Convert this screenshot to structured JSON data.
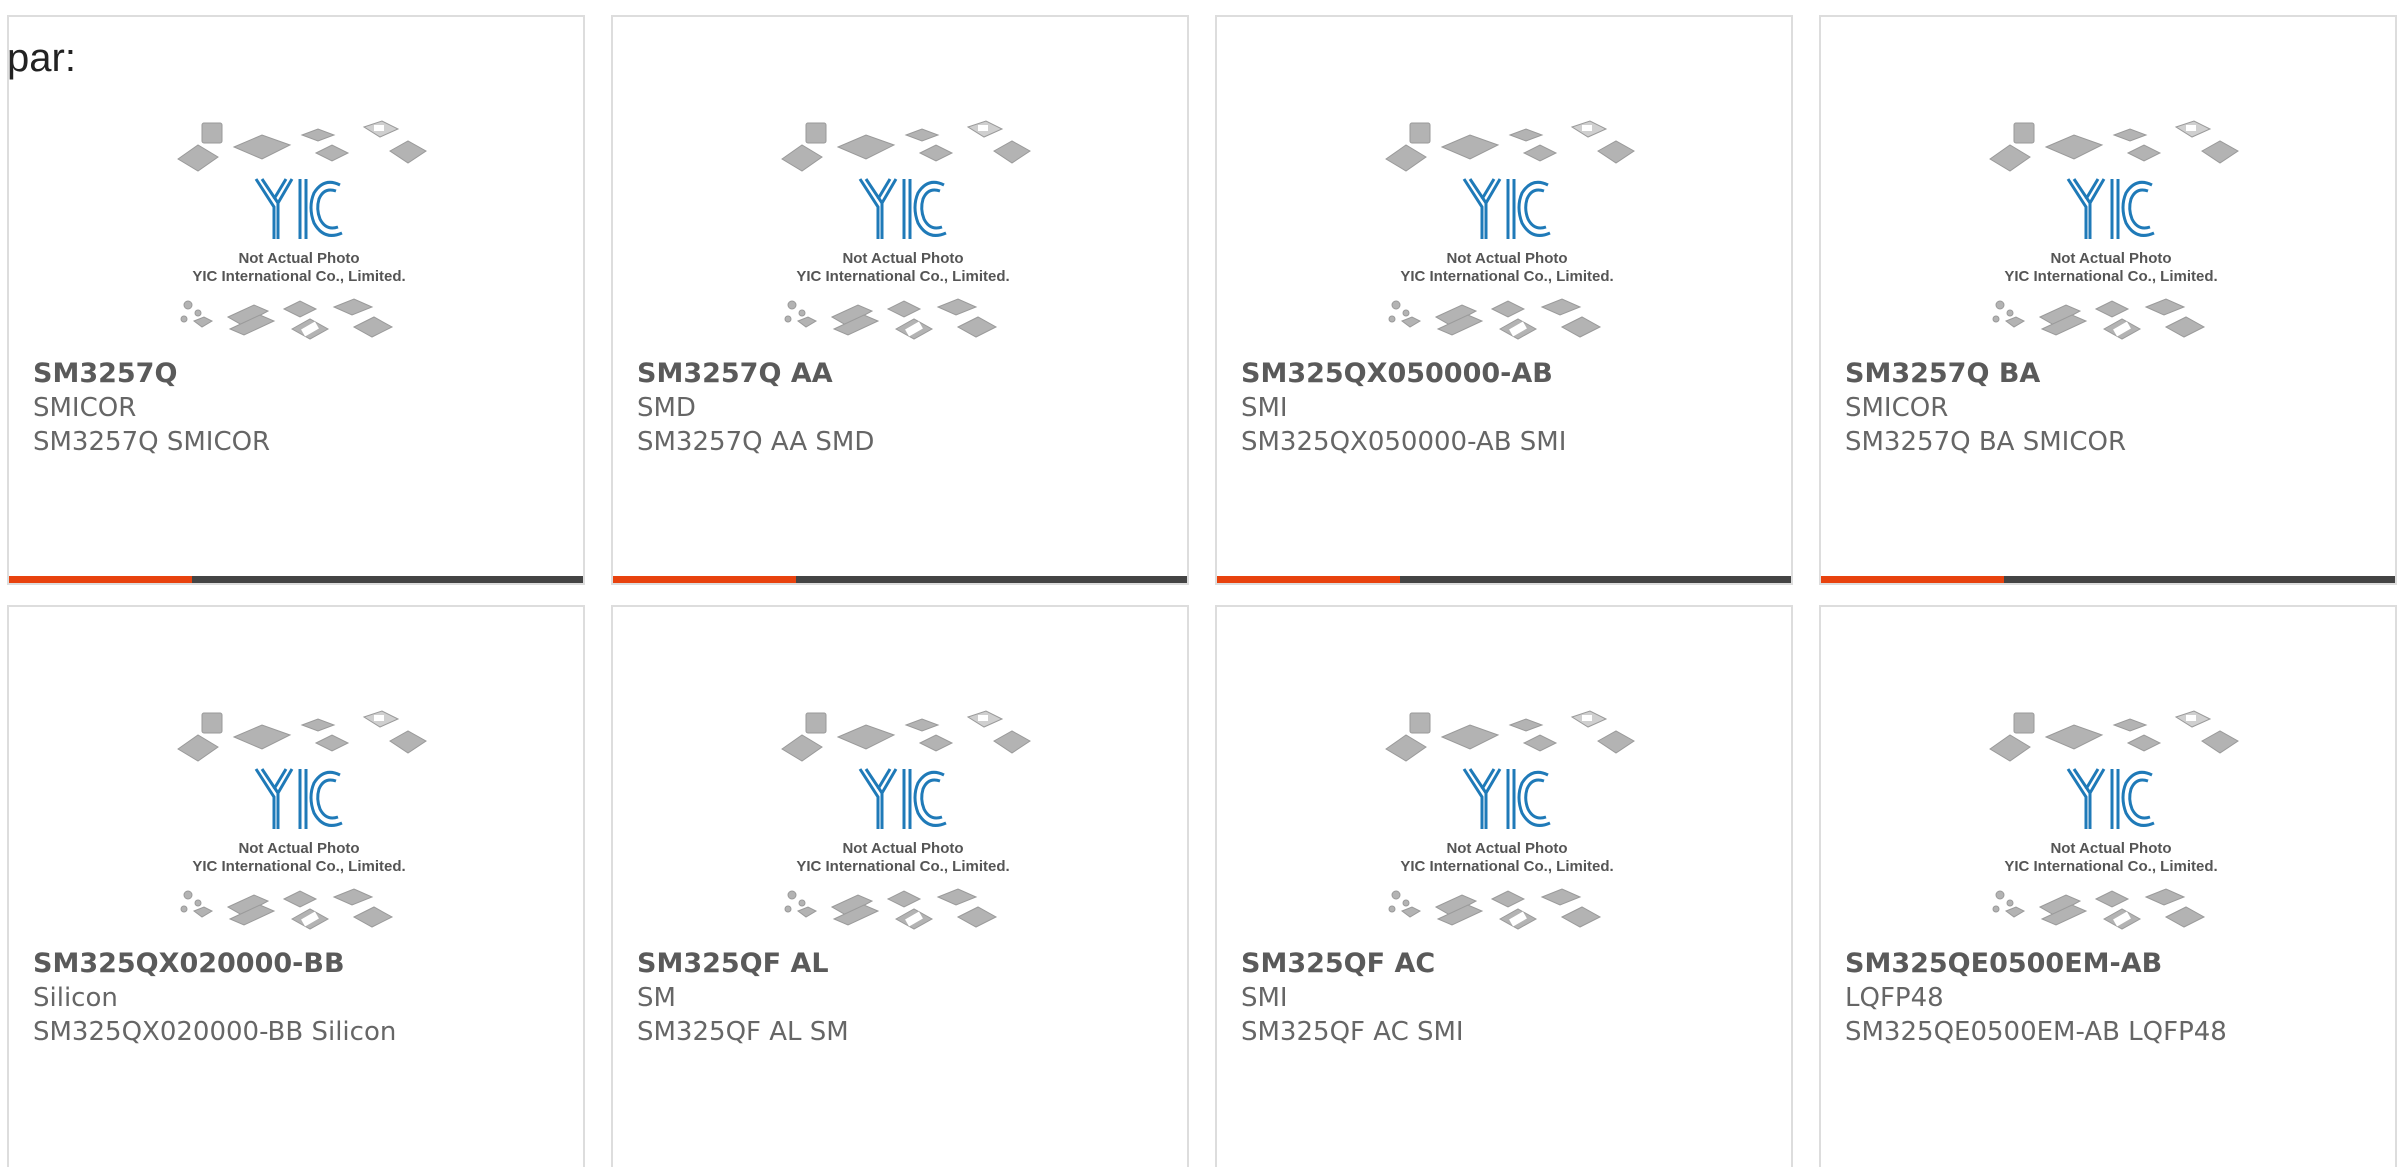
{
  "page": {
    "label": "par:"
  },
  "colors": {
    "accent": "#e8420e",
    "bar": "#444444",
    "logo_blue": "#1f7ab8",
    "chip_gray": "#aaaaaa",
    "text": "#666666"
  },
  "thumbnail": {
    "logo": "YIC",
    "caption_line1": "Not Actual Photo",
    "caption_line2": "YIC International Co., Limited."
  },
  "products": [
    {
      "part": "SM3257Q",
      "manufacturer": "SMICOR",
      "description": "SM3257Q SMICOR",
      "show_bar": true
    },
    {
      "part": "SM3257Q AA",
      "manufacturer": "SMD",
      "description": "SM3257Q AA SMD",
      "show_bar": true
    },
    {
      "part": "SM325QX050000-AB",
      "manufacturer": "SMI",
      "description": "SM325QX050000-AB SMI",
      "show_bar": true
    },
    {
      "part": "SM3257Q BA",
      "manufacturer": "SMICOR",
      "description": "SM3257Q BA SMICOR",
      "show_bar": true
    },
    {
      "part": "SM325QX020000-BB",
      "manufacturer": "Silicon",
      "description": "SM325QX020000-BB Silicon",
      "show_bar": false
    },
    {
      "part": "SM325QF AL",
      "manufacturer": "SM",
      "description": "SM325QF AL SM",
      "show_bar": false
    },
    {
      "part": "SM325QF AC",
      "manufacturer": "SMI",
      "description": "SM325QF AC SMI",
      "show_bar": false
    },
    {
      "part": "SM325QE0500EM-AB",
      "manufacturer": "LQFP48",
      "description": "SM325QE0500EM-AB LQFP48",
      "show_bar": false
    }
  ]
}
